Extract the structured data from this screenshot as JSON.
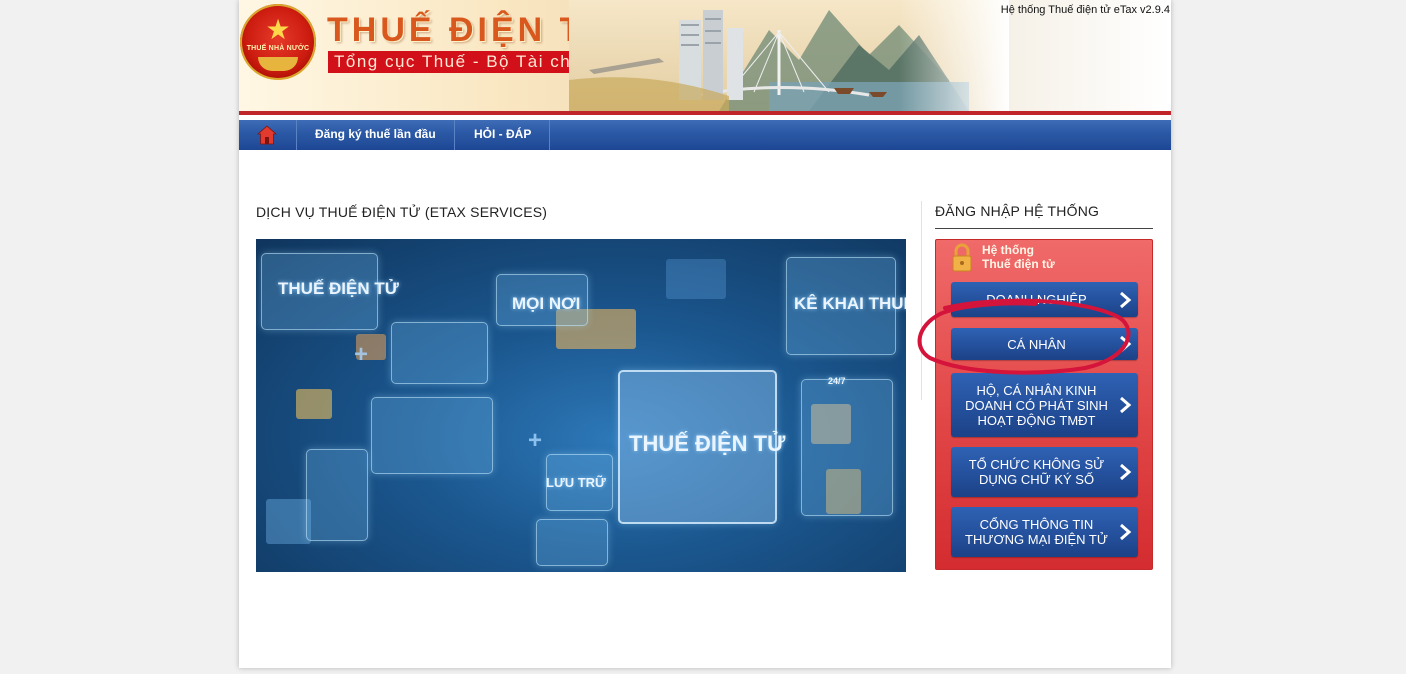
{
  "header": {
    "emblem_text": "THUẾ NHÀ NƯỚC",
    "brand_title": "THUẾ ĐIỆN TỬ",
    "brand_subtitle": "Tổng cục Thuế - Bộ Tài chính",
    "version_text": "Hệ thống Thuế điện tử eTax v2.9.4"
  },
  "nav": {
    "home_icon": "home-icon",
    "items": [
      {
        "label": "Đăng ký thuế lần đầu"
      },
      {
        "label": "HỎI - ĐÁP"
      }
    ]
  },
  "main": {
    "title": "DỊCH VỤ THUẾ ĐIỆN TỬ (ETAX SERVICES)",
    "banner_texts": {
      "t1": "THUẾ ĐIỆN TỬ",
      "t2": "MỌI NƠI",
      "t3": "KÊ KHAI THUẾ",
      "t4": "THUẾ ĐIỆN TỬ",
      "t5": "LƯU TRỮ",
      "t6": "24/7"
    }
  },
  "login": {
    "title": "ĐĂNG NHẬP HỆ THỐNG",
    "box_label_line1": "Hệ thống",
    "box_label_line2": "Thuế điện tử",
    "lock_icon": "lock-icon",
    "buttons": [
      {
        "label": "DOANH NGHIỆP"
      },
      {
        "label": "CÁ NHÂN"
      },
      {
        "label": "HỘ, CÁ NHÂN KINH DOANH CÓ PHÁT SINH HOẠT ĐỘNG TMĐT"
      },
      {
        "label": "TỔ CHỨC KHÔNG SỬ DỤNG CHỮ KÝ SỐ"
      },
      {
        "label": "CỔNG THÔNG TIN THƯƠNG MẠI ĐIỆN TỬ"
      }
    ]
  },
  "colors": {
    "nav_blue": "#2b58a4",
    "login_red": "#e44c4c",
    "button_blue": "#24509c",
    "brand_orange": "#d9581e",
    "highlight_red": "#d4143a"
  }
}
